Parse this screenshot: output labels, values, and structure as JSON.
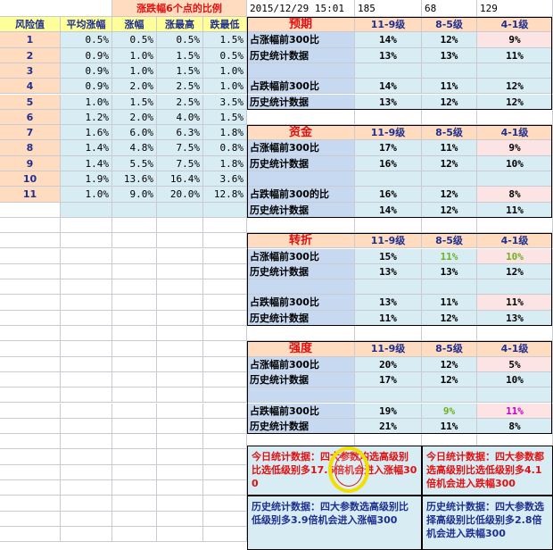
{
  "colors": {
    "yellow_bg": "#ffff99",
    "peach_bg": "#ffdcc0",
    "light_blue_bg": "#d8ecf4",
    "section_blue_bg": "#c6d9f1",
    "pink_bg": "#fce4e4",
    "title_red": "#e01010",
    "header_navy": "#1f2f8f",
    "green_text": "#70b020",
    "magenta_text": "#c800c8",
    "highlight_circle": "#f0e000"
  },
  "top": {
    "datetime": "2015/12/29 15:01",
    "val1": "185",
    "val2": "68",
    "val3": "129"
  },
  "left": {
    "title": "涨跌幅6个点的比例",
    "headers": [
      "风险值",
      "平均涨幅",
      "涨幅",
      "涨最高",
      "跌最低"
    ],
    "rows": [
      [
        "1",
        "0.5%",
        "0.5%",
        "0.5%",
        "1.5%"
      ],
      [
        "2",
        "0.9%",
        "1.0%",
        "1.5%",
        "0.5%"
      ],
      [
        "3",
        "0.9%",
        "1.0%",
        "1.5%",
        "1.0%"
      ],
      [
        "4",
        "0.9%",
        "2.0%",
        "2.5%",
        "1.0%"
      ],
      [
        "5",
        "1.0%",
        "1.5%",
        "2.5%",
        "3.5%"
      ],
      [
        "6",
        "1.2%",
        "2.0%",
        "4.0%",
        "1.5%"
      ],
      [
        "7",
        "1.6%",
        "6.0%",
        "6.3%",
        "1.8%"
      ],
      [
        "8",
        "1.4%",
        "4.8%",
        "7.5%",
        "0.8%"
      ],
      [
        "9",
        "1.4%",
        "5.5%",
        "7.5%",
        "1.8%"
      ],
      [
        "10",
        "1.9%",
        "13.6%",
        "16.4%",
        "3.6%"
      ],
      [
        "11",
        "1.0%",
        "9.0%",
        "20.0%",
        "12.8%"
      ]
    ]
  },
  "col_headers": [
    "11-9级",
    "8-5级",
    "4-1级"
  ],
  "sections": [
    {
      "title": "预期",
      "rows": [
        [
          "占涨幅前300比",
          "14%",
          "12%",
          "9%"
        ],
        [
          "历史统计数据",
          "13%",
          "13%",
          "11%"
        ],
        [
          "",
          "",
          "",
          ""
        ],
        [
          "占跌幅前300比",
          "14%",
          "11%",
          "12%"
        ],
        [
          "历史统计数据",
          "13%",
          "12%",
          "12%"
        ]
      ]
    },
    {
      "title": "资金",
      "rows": [
        [
          "占涨幅前300比",
          "17%",
          "11%",
          "9%"
        ],
        [
          "历史统计数据",
          "16%",
          "12%",
          "10%"
        ],
        [
          "",
          "",
          "",
          ""
        ],
        [
          "占跌幅前300的比",
          "16%",
          "12%",
          "8%"
        ],
        [
          "历史统计数据",
          "14%",
          "12%",
          "11%"
        ]
      ]
    },
    {
      "title": "转折",
      "rows": [
        [
          "占涨幅前300比",
          "15%",
          "11%",
          "10%"
        ],
        [
          "历史统计数据",
          "13%",
          "13%",
          "12%"
        ],
        [
          "",
          "",
          "",
          ""
        ],
        [
          "占跌幅前300比",
          "13%",
          "11%",
          "11%"
        ],
        [
          "历史统计数据",
          "11%",
          "12%",
          "13%"
        ]
      ]
    },
    {
      "title": "强度",
      "rows": [
        [
          "占涨幅前300比",
          "20%",
          "12%",
          "5%"
        ],
        [
          "历史统计数据",
          "17%",
          "12%",
          "10%"
        ],
        [
          "",
          "",
          "",
          ""
        ],
        [
          "占跌幅前300比",
          "19%",
          "9%",
          "11%"
        ],
        [
          "历史统计数据",
          "21%",
          "11%",
          "8%"
        ]
      ]
    }
  ],
  "notes": {
    "today_up": "今日统计数据：四大参数均选高级别比选低级别多17.6倍机会进入涨幅300",
    "today_down": "今日统计数据：四大参数都选高级别比选低级别多4.1倍机会进入跌幅300",
    "hist_up": "历史统计数据：四大参数选高级别比低级别多3.9倍机会进入涨幅300",
    "hist_down": "历史统计数据：四大参数选择高级别比低级别多2.8倍机会进入跌幅300"
  }
}
